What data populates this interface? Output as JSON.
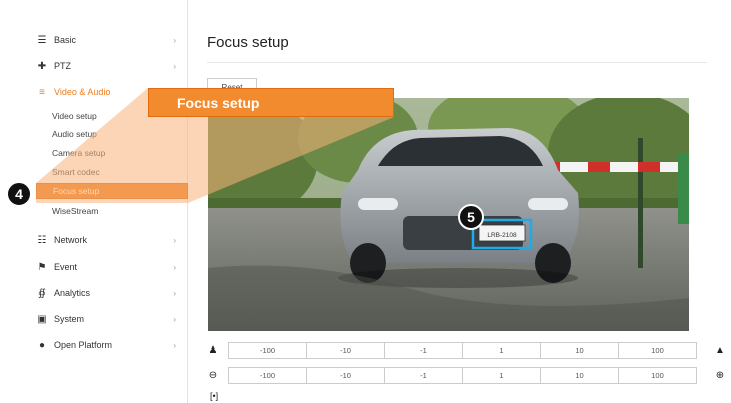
{
  "sidebar": {
    "items": [
      {
        "label": "Basic",
        "icon": "list-icon"
      },
      {
        "label": "PTZ",
        "icon": "move-icon"
      },
      {
        "label": "Video & Audio",
        "icon": "menu-icon",
        "active": true
      },
      {
        "label": "Network",
        "icon": "network-icon"
      },
      {
        "label": "Event",
        "icon": "event-icon"
      },
      {
        "label": "Analytics",
        "icon": "analytics-icon"
      },
      {
        "label": "System",
        "icon": "system-icon"
      },
      {
        "label": "Open Platform",
        "icon": "platform-icon"
      }
    ],
    "sub_items": [
      {
        "label": "Video setup"
      },
      {
        "label": "Audio setup"
      },
      {
        "label": "Camera setup"
      },
      {
        "label": "Smart codec"
      },
      {
        "label": "Focus setup",
        "selected": true
      },
      {
        "label": "WiseStream"
      }
    ]
  },
  "callout": {
    "label": "Focus setup",
    "step_4": "4",
    "step_5": "5"
  },
  "main": {
    "title": "Focus setup",
    "reset_label": "Reset",
    "plate_text": "LRB-2108"
  },
  "zoom_row": {
    "values": [
      "-100",
      "-10",
      "-1",
      "1",
      "10",
      "100"
    ]
  },
  "focus_row": {
    "values": [
      "-100",
      "-10",
      "-1",
      "1",
      "10",
      "100"
    ]
  },
  "colors": {
    "accent": "#f07c1e",
    "callout": "#f28a2e"
  }
}
